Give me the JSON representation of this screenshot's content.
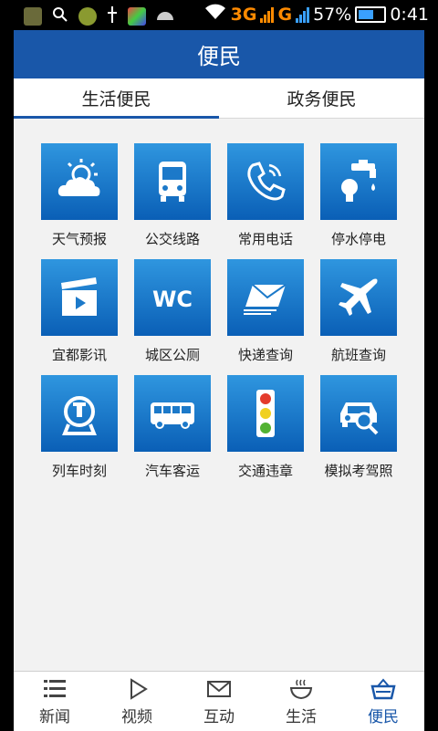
{
  "statusbar": {
    "icons": [
      "notification-icon",
      "search-icon",
      "app-icon",
      "usb-icon",
      "photo-icon",
      "android-icon",
      "wifi-icon"
    ],
    "network1": "3G",
    "network2": "G",
    "battery": "57%",
    "time": "0:41"
  },
  "header": {
    "title": "便民"
  },
  "tabs": [
    {
      "label": "生活便民",
      "active": true
    },
    {
      "label": "政务便民",
      "active": false
    }
  ],
  "grid": [
    {
      "label": "天气预报",
      "icon": "weather-icon"
    },
    {
      "label": "公交线路",
      "icon": "bus-icon"
    },
    {
      "label": "常用电话",
      "icon": "phone-icon"
    },
    {
      "label": "停水停电",
      "icon": "water-electric-icon"
    },
    {
      "label": "宜都影讯",
      "icon": "movie-icon"
    },
    {
      "label": "城区公厕",
      "icon": "wc-icon"
    },
    {
      "label": "快递查询",
      "icon": "express-icon"
    },
    {
      "label": "航班查询",
      "icon": "plane-icon"
    },
    {
      "label": "列车时刻",
      "icon": "train-icon"
    },
    {
      "label": "汽车客运",
      "icon": "coach-icon"
    },
    {
      "label": "交通违章",
      "icon": "traffic-light-icon"
    },
    {
      "label": "模拟考驾照",
      "icon": "driving-test-icon"
    }
  ],
  "bottomnav": [
    {
      "label": "新闻",
      "icon": "list-icon",
      "active": false
    },
    {
      "label": "视频",
      "icon": "play-icon",
      "active": false
    },
    {
      "label": "互动",
      "icon": "mail-icon",
      "active": false
    },
    {
      "label": "生活",
      "icon": "bowl-icon",
      "active": false
    },
    {
      "label": "便民",
      "icon": "basket-icon",
      "active": true
    }
  ],
  "colors": {
    "accent": "#1957a9",
    "tile_top": "#2f96df",
    "tile_bottom": "#0a5fb6",
    "network": "#ff8a00"
  }
}
